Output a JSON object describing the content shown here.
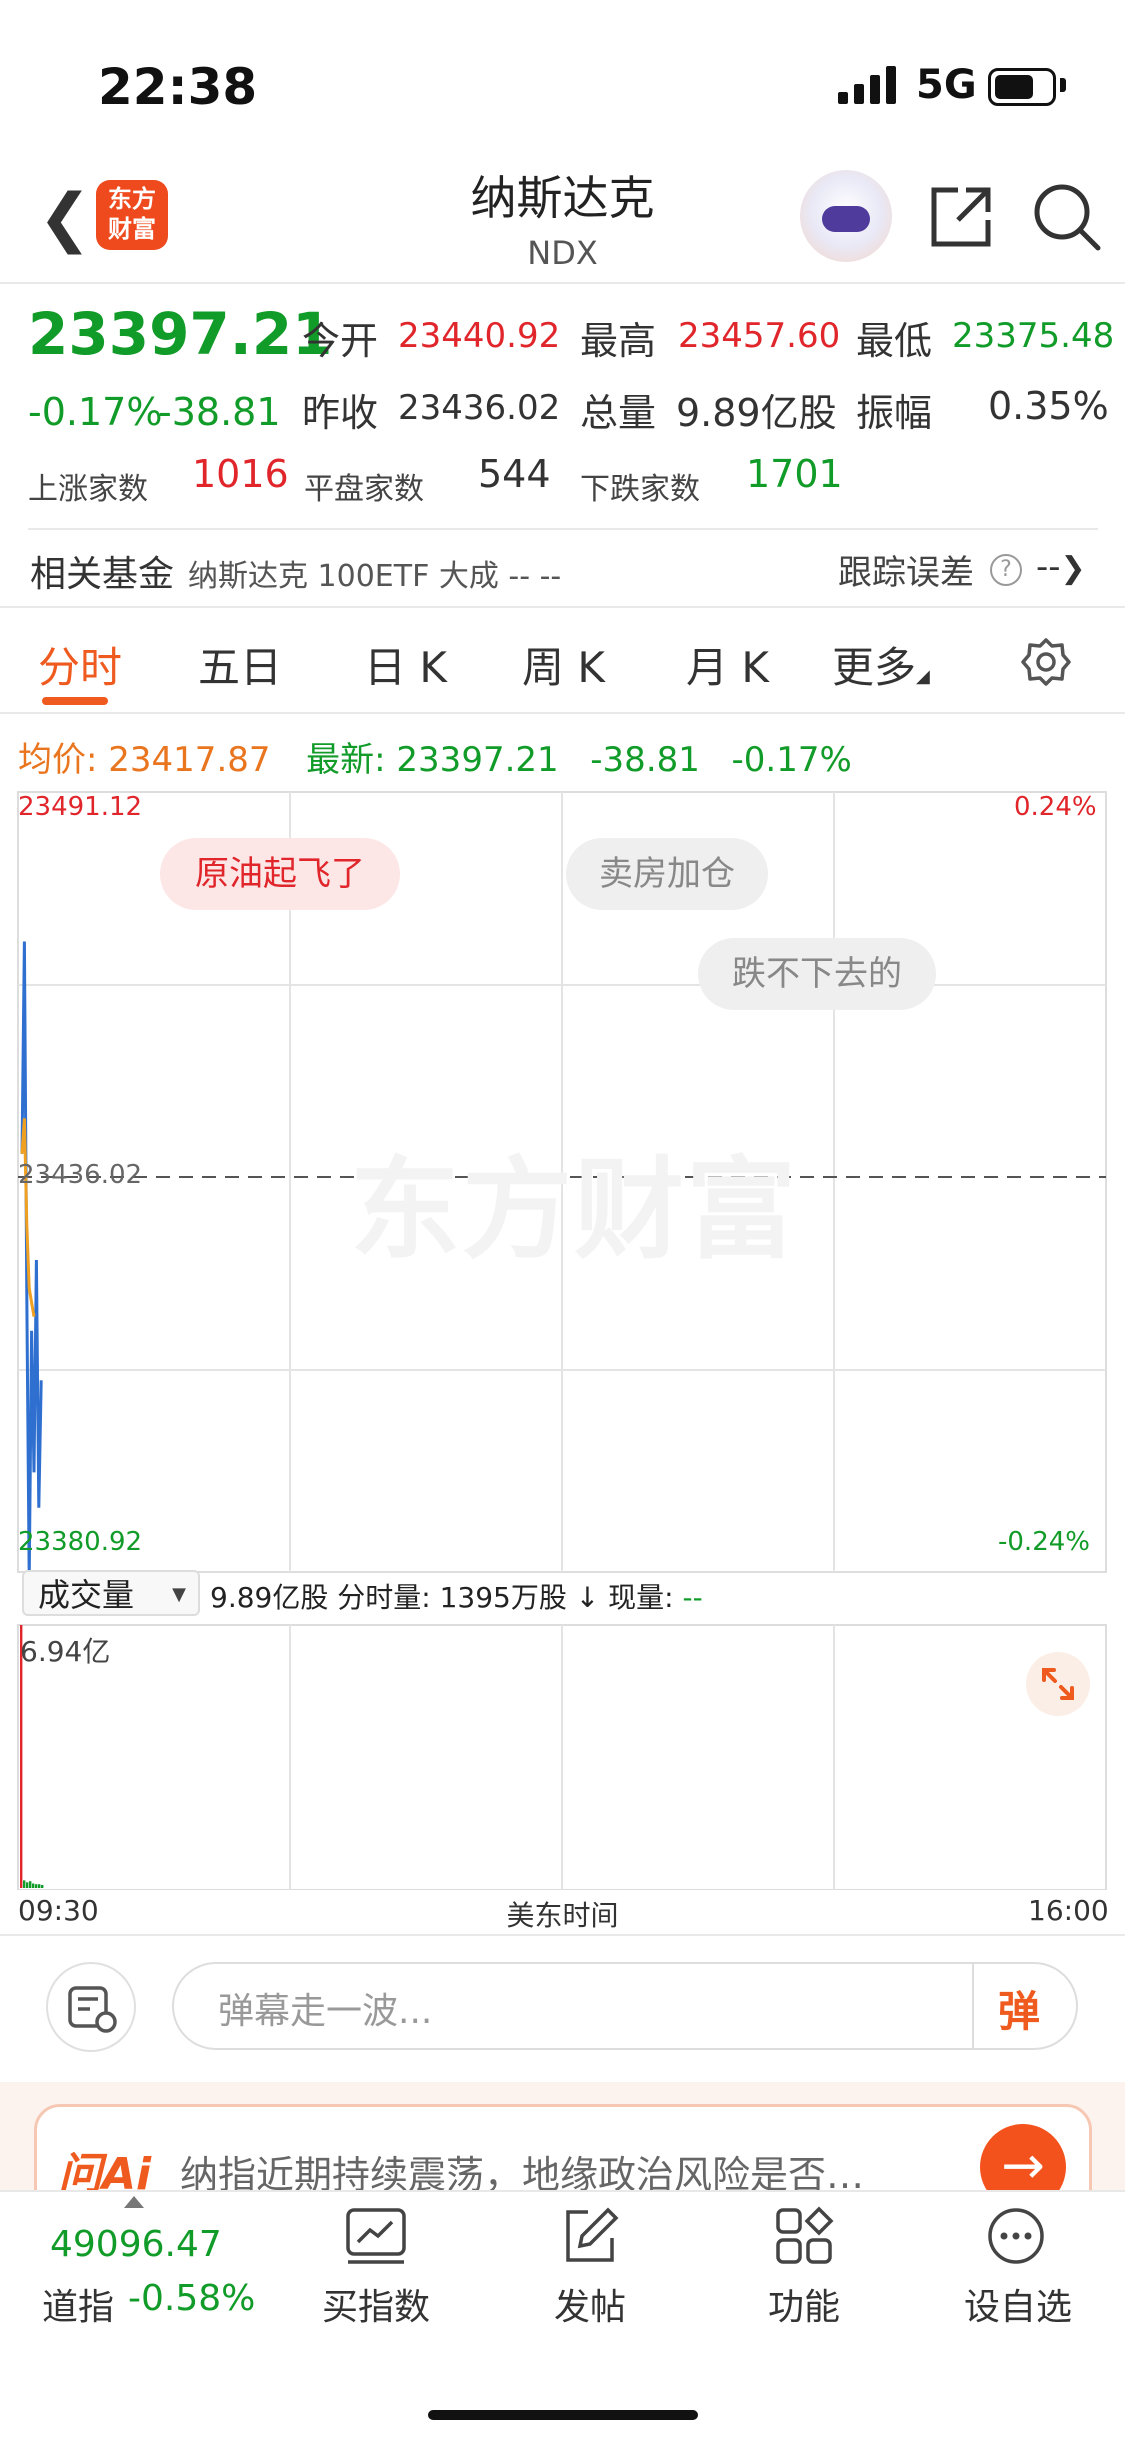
{
  "status_bar": {
    "time": "22:38",
    "network": "5G"
  },
  "header": {
    "logo_line1": "东方",
    "logo_line2": "财富",
    "title": "纳斯达克",
    "subtitle": "NDX"
  },
  "quote": {
    "price": "23397.21",
    "change_pct": "-0.17%",
    "change": "-38.81",
    "open_label": "今开",
    "open": "23440.92",
    "high_label": "最高",
    "high": "23457.60",
    "low_label": "最低",
    "low": "23375.48",
    "prev_close_label": "昨收",
    "prev_close": "23436.02",
    "volume_label": "总量",
    "volume": "9.89亿股",
    "amplitude_label": "振幅",
    "amplitude": "0.35%",
    "up_label": "上涨家数",
    "up": "1016",
    "flat_label": "平盘家数",
    "flat": "544",
    "down_label": "下跌家数",
    "down": "1701"
  },
  "fund": {
    "label": "相关基金",
    "name": "纳斯达克 100ETF 大成 -- --",
    "track_label": "跟踪误差",
    "track_value": "--"
  },
  "tabs": [
    {
      "label": "分时",
      "active": true
    },
    {
      "label": "五日"
    },
    {
      "label": "日 K"
    },
    {
      "label": "周 K"
    },
    {
      "label": "月 K"
    },
    {
      "label": "更多"
    }
  ],
  "info": {
    "avg_label": "均价:",
    "avg": "23417.87",
    "latest_label": "最新:",
    "latest": "23397.21",
    "latest_change": "-38.81",
    "latest_pct": "-0.17%"
  },
  "chart_data": {
    "type": "line",
    "title": "",
    "y_max": "23491.12",
    "y_mid": "23436.02",
    "y_min": "23380.92",
    "pct_max": "0.24%",
    "pct_min": "-0.24%",
    "ylim": [
      23380.92,
      23491.12
    ],
    "baseline": 23436.02,
    "x_start": "09:30",
    "x_mid": "美东时间",
    "x_end": "16:00",
    "watermark": "东方财富",
    "series": [
      {
        "values": [
          23440,
          23470,
          23420,
          23380,
          23415,
          23395,
          23425,
          23390,
          23408
        ]
      },
      {
        "values": [
          23440,
          23445,
          23430,
          23421,
          23419,
          23417
        ]
      }
    ],
    "volume": {
      "max_label": "6.94亿",
      "bars": [
        6.94,
        0.2,
        0.15,
        0.18,
        0.12,
        0.1,
        0.1,
        0.08
      ]
    }
  },
  "danmaku": [
    "原油起飞了",
    "卖房加仓",
    "跌不下去的"
  ],
  "volume_panel": {
    "selector": "成交量",
    "info_total": "9.89亿股",
    "info_fs_label": "分时量:",
    "info_fs": "1395万股",
    "info_arrow": "↓",
    "info_now_label": "现量:",
    "info_now": "--"
  },
  "danmaku_input": {
    "placeholder": "弹幕走一波...",
    "send": "弹"
  },
  "ai_banner": {
    "logo": "问Ai",
    "text": "纳指近期持续震荡，地缘政治风险是否…"
  },
  "bottom_nav": {
    "dow_value": "49096.47",
    "dow_name": "道指",
    "dow_pct": "-0.58%",
    "items": [
      {
        "label": "买指数"
      },
      {
        "label": "发帖"
      },
      {
        "label": "功能"
      },
      {
        "label": "设自选"
      }
    ]
  },
  "colors": {
    "red": "#e0252b",
    "green": "#119b28",
    "accent": "#ef5a1e",
    "line_price": "#2f6fd0",
    "line_avg": "#f0a020"
  }
}
